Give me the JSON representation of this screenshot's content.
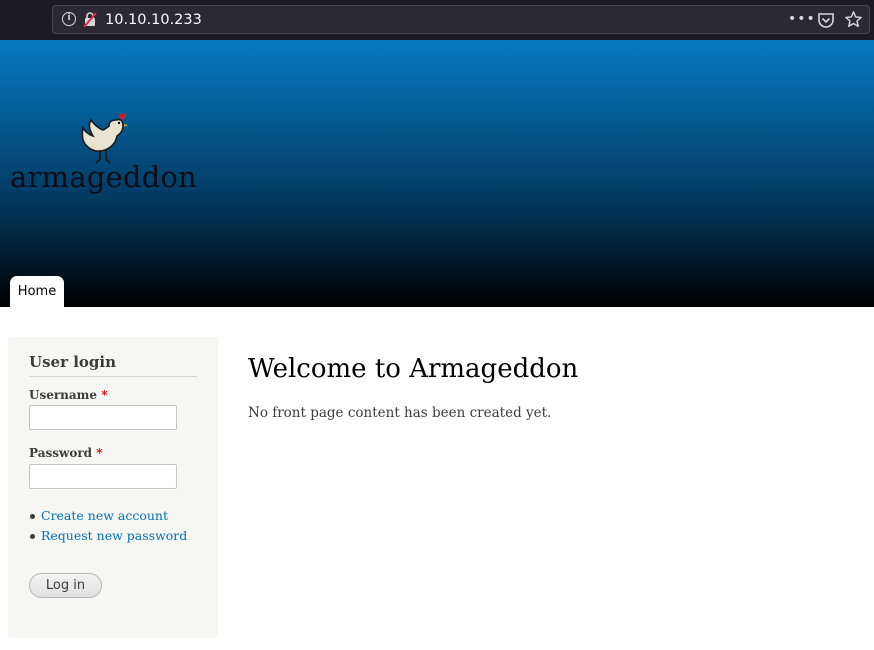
{
  "browser": {
    "url": "10.10.10.233",
    "icons": [
      "info-icon",
      "insecure-connection-icon",
      "more-icon",
      "pocket-icon",
      "star-icon"
    ]
  },
  "header": {
    "logo_text": "armageddon",
    "logo_icon": "rooster-icon",
    "nav": {
      "home_label": "Home"
    }
  },
  "sidebar": {
    "block_title": "User login",
    "username": {
      "label": "Username",
      "required_marker": "*",
      "value": ""
    },
    "password": {
      "label": "Password",
      "required_marker": "*",
      "value": ""
    },
    "links": [
      {
        "label": "Create new account"
      },
      {
        "label": "Request new password"
      }
    ],
    "login_button": "Log in"
  },
  "main": {
    "title": "Welcome to Armageddon",
    "content": "No front page content has been created yet."
  },
  "colors": {
    "header_top": "#0779bf",
    "header_bottom": "#000000",
    "link": "#0071b3",
    "required": "#e00000",
    "sidebar_bg": "#f6f6f2"
  }
}
